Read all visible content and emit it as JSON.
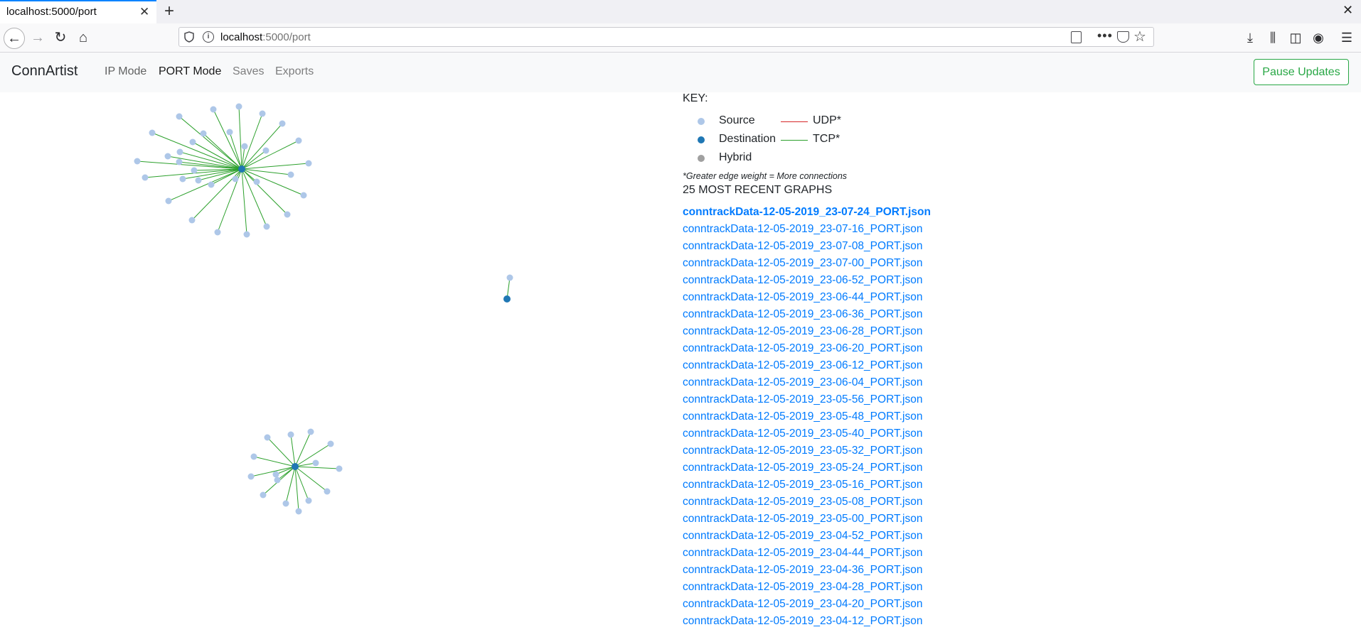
{
  "browser": {
    "tab_title": "localhost:5000/port",
    "url_host": "localhost",
    "url_rest": ":5000/port"
  },
  "app": {
    "brand": "ConnArtist",
    "nav": {
      "ip_mode": "IP Mode",
      "port_mode": "PORT Mode",
      "saves": "Saves",
      "exports": "Exports"
    },
    "pause_button": "Pause Updates"
  },
  "colors": {
    "source": "#aec7e8",
    "destination": "#1f77b4",
    "hybrid": "#a0a0a0",
    "udp": "#d62728",
    "tcp": "#2ca02c",
    "link": "#007bff",
    "pause": "#28a745"
  },
  "key": {
    "title": "KEY:",
    "source": "Source",
    "destination": "Destination",
    "hybrid": "Hybrid",
    "udp": "UDP*",
    "tcp": "TCP*",
    "note": "*Greater edge weight = More connections"
  },
  "recent": {
    "title": "25 MOST RECENT GRAPHS",
    "files": [
      "conntrackData-12-05-2019_23-07-24_PORT.json",
      "conntrackData-12-05-2019_23-07-16_PORT.json",
      "conntrackData-12-05-2019_23-07-08_PORT.json",
      "conntrackData-12-05-2019_23-07-00_PORT.json",
      "conntrackData-12-05-2019_23-06-52_PORT.json",
      "conntrackData-12-05-2019_23-06-44_PORT.json",
      "conntrackData-12-05-2019_23-06-36_PORT.json",
      "conntrackData-12-05-2019_23-06-28_PORT.json",
      "conntrackData-12-05-2019_23-06-20_PORT.json",
      "conntrackData-12-05-2019_23-06-12_PORT.json",
      "conntrackData-12-05-2019_23-06-04_PORT.json",
      "conntrackData-12-05-2019_23-05-56_PORT.json",
      "conntrackData-12-05-2019_23-05-48_PORT.json",
      "conntrackData-12-05-2019_23-05-40_PORT.json",
      "conntrackData-12-05-2019_23-05-32_PORT.json",
      "conntrackData-12-05-2019_23-05-24_PORT.json",
      "conntrackData-12-05-2019_23-05-16_PORT.json",
      "conntrackData-12-05-2019_23-05-08_PORT.json",
      "conntrackData-12-05-2019_23-05-00_PORT.json",
      "conntrackData-12-05-2019_23-04-52_PORT.json",
      "conntrackData-12-05-2019_23-04-44_PORT.json",
      "conntrackData-12-05-2019_23-04-36_PORT.json",
      "conntrackData-12-05-2019_23-04-28_PORT.json",
      "conntrackData-12-05-2019_23-04-20_PORT.json",
      "conntrackData-12-05-2019_23-04-12_PORT.json"
    ]
  },
  "graph": {
    "clusters": [
      {
        "hub_type": "destination",
        "protocol": "tcp",
        "leaf_count": 32
      },
      {
        "hub_type": "destination",
        "protocol": "tcp",
        "leaf_count": 1
      },
      {
        "hub_type": "destination",
        "protocol": "tcp",
        "leaf_count": 15
      }
    ]
  }
}
